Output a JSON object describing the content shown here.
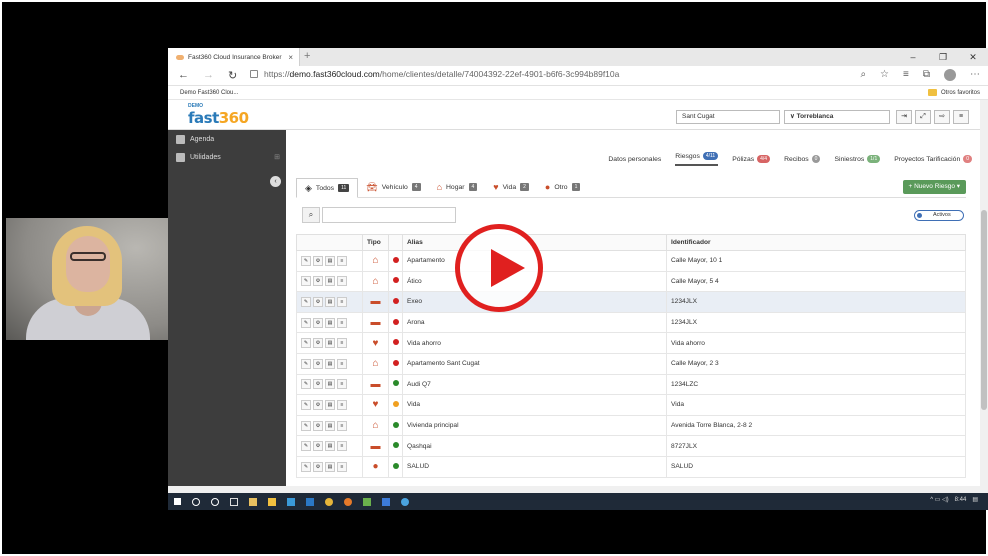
{
  "browser": {
    "tab_title": "Fast360 Cloud Insurance Broker",
    "url_prefix": "https://",
    "url_host": "demo.fast360cloud.com",
    "url_path": "/home/clientes/detalle/74004392-22ef-4901-b6f6-3c994b89f10a",
    "favorites_item": "Demo Fast360 Clou...",
    "other_favorites": "Otros favoritos"
  },
  "app": {
    "logo_demo": "DEMO",
    "logo_brand": "fast",
    "logo_brand_num": "360",
    "selector_office": "Sant Cugat",
    "selector_client": "Torreblanca"
  },
  "sidebar": {
    "items": [
      {
        "label": "Agenda"
      },
      {
        "label": "Utilidades"
      }
    ]
  },
  "subtabs": [
    {
      "label": "Datos personales",
      "badge": ""
    },
    {
      "label": "Riesgos",
      "badge": "4/11"
    },
    {
      "label": "Pólizas",
      "badge": "4/4"
    },
    {
      "label": "Recibos",
      "badge": "0"
    },
    {
      "label": "Siniestros",
      "badge": "1/1"
    },
    {
      "label": "Proyectos Tarificación",
      "badge": "0"
    }
  ],
  "risktabs": [
    {
      "label": "Todos",
      "badge": "11"
    },
    {
      "label": "Vehículo",
      "badge": "4"
    },
    {
      "label": "Hogar",
      "badge": "4"
    },
    {
      "label": "Vida",
      "badge": "2"
    },
    {
      "label": "Otro",
      "badge": "1"
    }
  ],
  "new_risk_button": "+ Nuevo Riesgo ▾",
  "toggle_label": "Activos",
  "table": {
    "headers": {
      "tipo": "Tipo",
      "alias": "Alias",
      "identificador": "Identificador"
    },
    "rows": [
      {
        "alias": "Apartamento",
        "id": "Calle Mayor, 10 1"
      },
      {
        "alias": "Ático",
        "id": "Calle Mayor, 5 4"
      },
      {
        "alias": "Exeo",
        "id": "1234JLX"
      },
      {
        "alias": "Arona",
        "id": "1234JLX"
      },
      {
        "alias": "Vida ahorro",
        "id": "Vida ahorro"
      },
      {
        "alias": "Apartamento Sant Cugat",
        "id": "Calle Mayor, 2 3"
      },
      {
        "alias": "Audi Q7",
        "id": "1234LZC"
      },
      {
        "alias": "Vida",
        "id": "Vida"
      },
      {
        "alias": "Vivienda principal",
        "id": "Avenida Torre Blanca, 2-8 2"
      },
      {
        "alias": "Qashqai",
        "id": "8727JLX"
      },
      {
        "alias": "SALUD",
        "id": "SALUD"
      }
    ]
  },
  "taskbar": {
    "time": "8:44"
  },
  "colors": {
    "accent_blue": "#3f6fb5",
    "risk_orange": "#c94d2a",
    "status_red": "#d22020",
    "status_green": "#2a8a2a",
    "new_button_green": "#5a9a5a",
    "play_red": "#e0201f"
  }
}
